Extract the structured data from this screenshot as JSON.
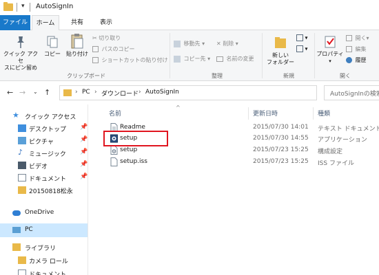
{
  "window": {
    "title": "AutoSignIn"
  },
  "ribbon_tabs": {
    "file": "ファイル",
    "home": "ホーム",
    "share": "共有",
    "view": "表示"
  },
  "ribbon": {
    "clipboard": {
      "pin_quick_access": [
        "クイック アクセ",
        "スにピン留め"
      ],
      "copy": "コピー",
      "paste": "貼り付け",
      "cut": "切り取り",
      "copy_path": "パスのコピー",
      "paste_shortcut": "ショートカットの貼り付け",
      "label": "クリップボード"
    },
    "organize": {
      "move_to": "移動先",
      "copy_to": "コピー先",
      "delete": "削除",
      "rename": "名前の変更",
      "label": "整理"
    },
    "new": {
      "new_folder": [
        "新しい",
        "フォルダー"
      ],
      "label": "新規"
    },
    "open": {
      "properties": "プロパティ",
      "open": "開く",
      "edit": "編集",
      "history": "履歴",
      "label": "開く"
    }
  },
  "address": {
    "crumbs": [
      "PC",
      "ダウンロード",
      "AutoSignIn"
    ],
    "search_placeholder": "AutoSignInの検索"
  },
  "nav_pane": {
    "quick_access": "クイック アクセス",
    "items": [
      "デスクトップ",
      "ピクチャ",
      "ミュージック",
      "ビデオ",
      "ドキュメント",
      "20150818松永"
    ],
    "onedrive": "OneDrive",
    "pc": "PC",
    "libraries": "ライブラリ",
    "lib_items": [
      "カメラ ロール",
      "ドキュメント"
    ]
  },
  "columns": {
    "name": "名前",
    "modified": "更新日時",
    "type": "種類"
  },
  "files": [
    {
      "name": "Readme",
      "modified": "2015/07/30 14:01",
      "type": "テキスト ドキュメント",
      "icon": "text-file-icon"
    },
    {
      "name": "setup",
      "modified": "2015/07/30 14:55",
      "type": "アプリケーション",
      "icon": "setup-app-icon"
    },
    {
      "name": "setup",
      "modified": "2015/07/23 15:25",
      "type": "構成設定",
      "icon": "config-file-icon"
    },
    {
      "name": "setup.iss",
      "modified": "2015/07/23 15:25",
      "type": "ISS ファイル",
      "icon": "blank-file-icon"
    }
  ],
  "colors": {
    "accent": "#1979ca",
    "highlight": "#e0141e",
    "selection": "#cce8ff",
    "folder": "#e9b949"
  }
}
